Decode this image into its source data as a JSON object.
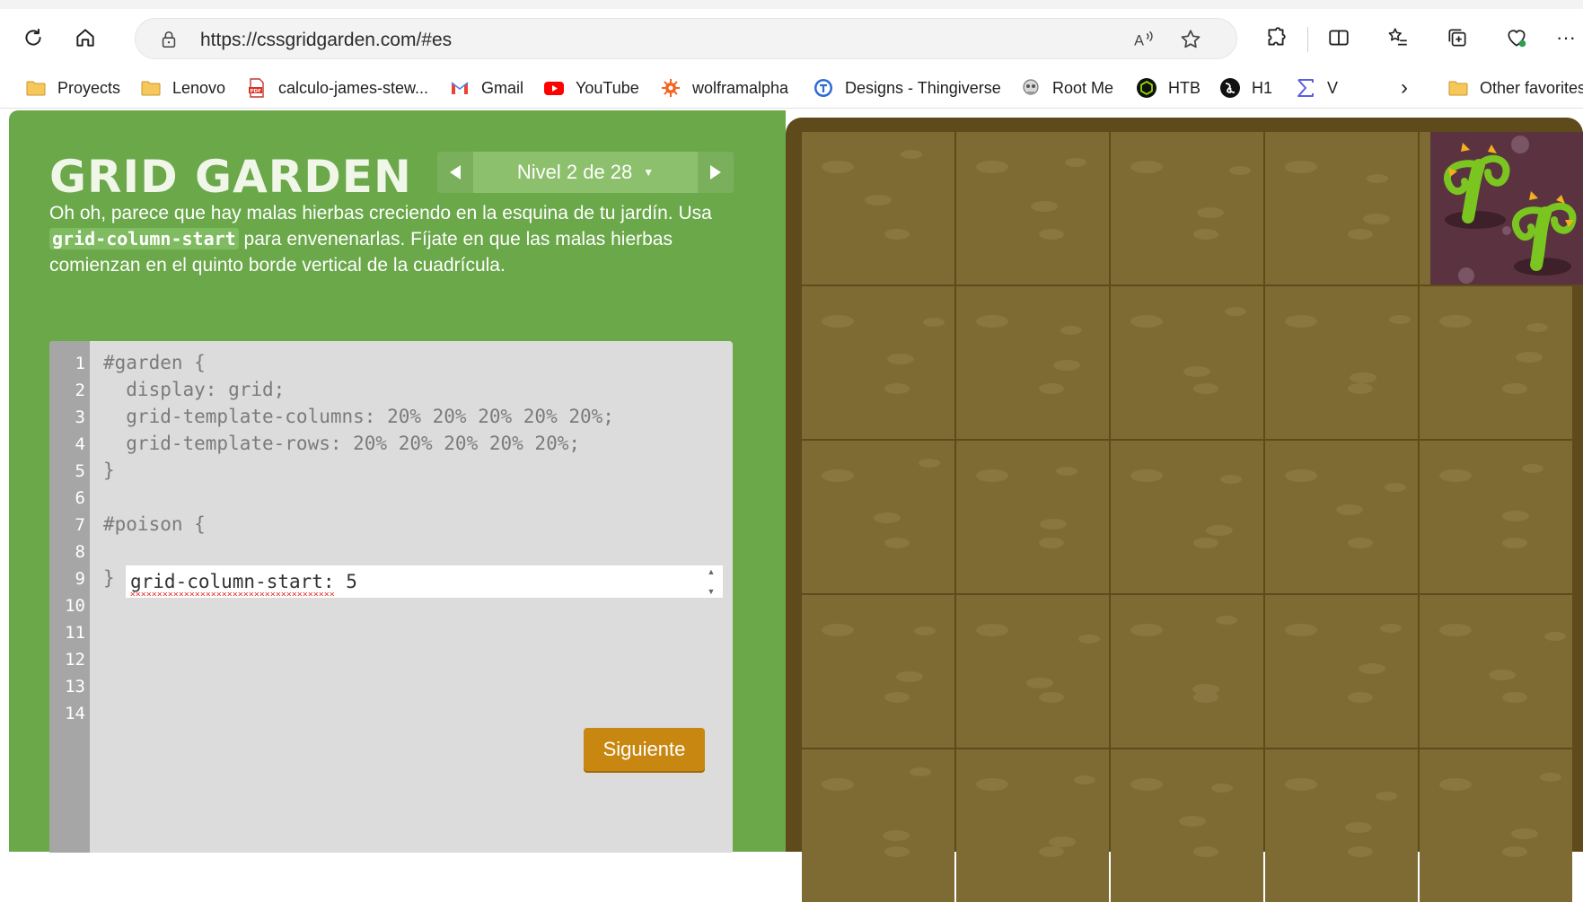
{
  "browser": {
    "url": "https://cssgridgarden.com/#es",
    "bookmarks": [
      {
        "label": "Proyects",
        "icon": "folder-icon"
      },
      {
        "label": "Lenovo",
        "icon": "folder-icon"
      },
      {
        "label": "calculo-james-stew...",
        "icon": "pdf-icon"
      },
      {
        "label": "Gmail",
        "icon": "gmail-icon"
      },
      {
        "label": "YouTube",
        "icon": "youtube-icon"
      },
      {
        "label": "wolframalpha",
        "icon": "wolfram-icon"
      },
      {
        "label": "Designs - Thingiverse",
        "icon": "thingiverse-icon"
      },
      {
        "label": "Root Me",
        "icon": "rootme-icon"
      },
      {
        "label": "HTB",
        "icon": "htb-icon"
      },
      {
        "label": "H1",
        "icon": "h1-icon"
      },
      {
        "label": "V",
        "icon": "sigma-icon"
      }
    ],
    "other_favorites": "Other favorites"
  },
  "game": {
    "title": "GRID GARDEN",
    "level_label": "Nivel 2 de 28",
    "instructions_part1": "Oh oh, parece que hay malas hierbas creciendo en la esquina de tu jardín. Usa ",
    "instructions_code": "grid-column-start",
    "instructions_part2": " para envenenarlas. Fíjate en que las malas hierbas comienzan en el quinto borde vertical de la cuadrícula.",
    "line_numbers": [
      "1",
      "2",
      "3",
      "4",
      "5",
      "6",
      "7",
      "8",
      "9",
      "10",
      "11",
      "12",
      "13",
      "14"
    ],
    "code_lines": [
      "#garden {",
      "  display: grid;",
      "  grid-template-columns: 20% 20% 20% 20% 20%;",
      "  grid-template-rows: 20% 20% 20% 20% 20%;",
      "}",
      "",
      "#poison {",
      "",
      "}"
    ],
    "input_value": "grid-column-start: 5",
    "next_button": "Siguiente"
  },
  "colors": {
    "panel_green": "#6aa84a",
    "button_orange": "#c88710",
    "soil": "#7e6a33",
    "poison": "#5b3340"
  }
}
